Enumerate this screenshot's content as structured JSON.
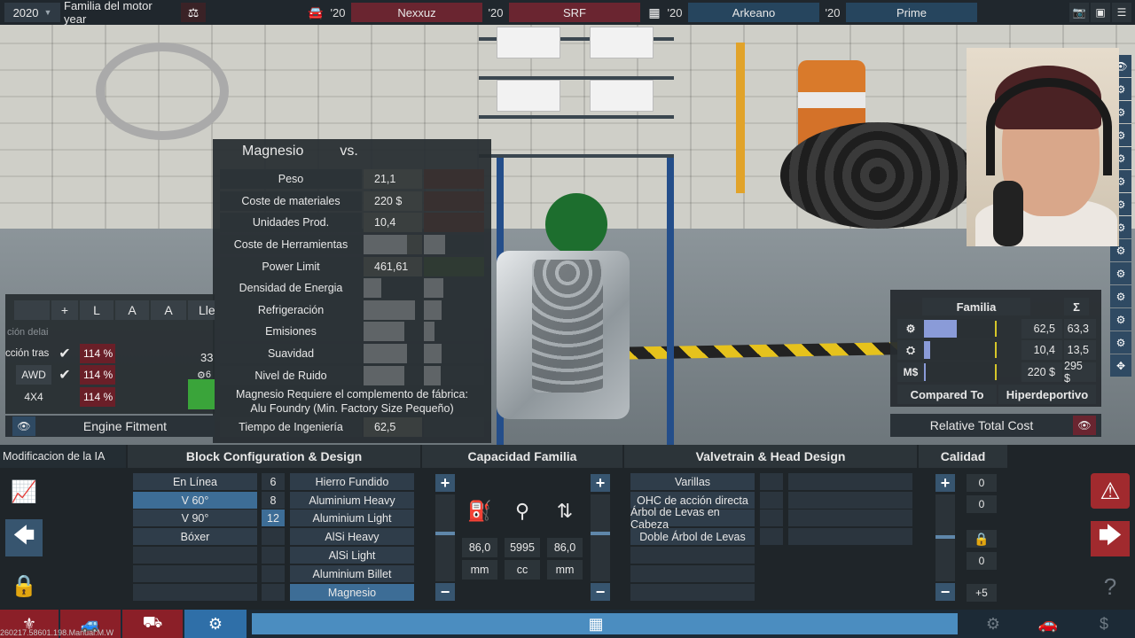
{
  "topbar": {
    "year": "2020",
    "family_label": "Familia del motor year",
    "rivals": [
      {
        "year": "'20",
        "name": "Nexxuz"
      },
      {
        "year": "'20",
        "name": "SRF"
      },
      {
        "year": "'20",
        "name": "Arkeano"
      },
      {
        "year": "'20",
        "name": "Prime"
      }
    ]
  },
  "material_panel": {
    "title": "Magnesio",
    "vs": "vs.",
    "rows": [
      {
        "label": "Peso",
        "value": "21,1"
      },
      {
        "label": "Coste de materiales",
        "value": "220 $"
      },
      {
        "label": "Unidades Prod.",
        "value": "10,4"
      },
      {
        "label": "Coste de Herramientas",
        "value": ""
      },
      {
        "label": "Power Limit",
        "value": "461,61"
      },
      {
        "label": "Densidad de Energia",
        "value": ""
      },
      {
        "label": "Refrigeración",
        "value": ""
      },
      {
        "label": "Emisiones",
        "value": ""
      },
      {
        "label": "Suavidad",
        "value": ""
      },
      {
        "label": "Nivel de Ruido",
        "value": ""
      }
    ],
    "bar_levels": {
      "tool_cost": 0.74,
      "energy_density": 0.3,
      "cooling": 0.88,
      "emissions": 0.7,
      "smoothness": 0.74,
      "noise": 0.7
    },
    "note_line1": "Magnesio Requiere el complemento de fábrica:",
    "note_line2": "Alu Foundry (Min. Factory Size Pequeño)",
    "engineering_label": "Tiempo de Ingeniería",
    "engineering_value": "62,5"
  },
  "drivetrain": {
    "headers": [
      "+",
      "L",
      "A",
      "A",
      "Lle"
    ],
    "row0_label": "ción delai",
    "rows": [
      {
        "label": "cción tras",
        "pct": "114 %"
      },
      {
        "label": "AWD",
        "pct": "114 %"
      },
      {
        "label": "4X4",
        "pct": "114 %"
      }
    ],
    "side_value": "33",
    "side_value2": "6",
    "fitment_label": "Engine Fitment"
  },
  "family_stats": {
    "header": "Familia",
    "sigma": "Σ",
    "rows": [
      {
        "icon": "engine-icon",
        "v1": "62,5",
        "v2": "63,3",
        "fill": 0.45
      },
      {
        "icon": "piston-icon",
        "v1": "10,4",
        "v2": "13,5",
        "fill": 0.08
      },
      {
        "icon": "money-icon",
        "icon_text": "M$",
        "v1": "220 $",
        "v2": "295 $",
        "fill": 0.03
      }
    ],
    "compared_to_label": "Compared To",
    "compared_to_value": "Hiperdeportivo",
    "relative_cost_label": "Relative Total Cost"
  },
  "bottom": {
    "ai_mod_label": "Modificacion de la IA",
    "block_title": "Block Configuration & Design",
    "layouts": [
      "En Línea",
      "V 60°",
      "V 90°",
      "Bóxer"
    ],
    "cylinders": [
      "6",
      "8",
      "12"
    ],
    "materials": [
      "Hierro Fundido",
      "Aluminium Heavy",
      "Aluminium Light",
      "AlSi Heavy",
      "AlSi Light",
      "Aluminium Billet",
      "Magnesio"
    ],
    "capacity_title": "Capacidad Familia",
    "bore": "86,0",
    "displacement": "5995",
    "stroke": "86,0",
    "bore_unit": "mm",
    "disp_unit": "cc",
    "stroke_unit": "mm",
    "valvetrain_title": "Valvetrain & Head Design",
    "valvetrains": [
      "Varillas",
      "OHC de acción directa",
      "Árbol de Levas en Cabeza",
      "Doble Árbol de Levas"
    ],
    "quality_title": "Calidad",
    "quality_values": [
      "0",
      "0",
      "0",
      "+5"
    ]
  },
  "version": "260217.58601.198.Manual:M.W",
  "colors": {
    "accent_blue": "#3d6d96",
    "rival_red": "#6a2530",
    "pct_red": "#6a1f28",
    "bar_lavender": "#8a9bd8"
  }
}
